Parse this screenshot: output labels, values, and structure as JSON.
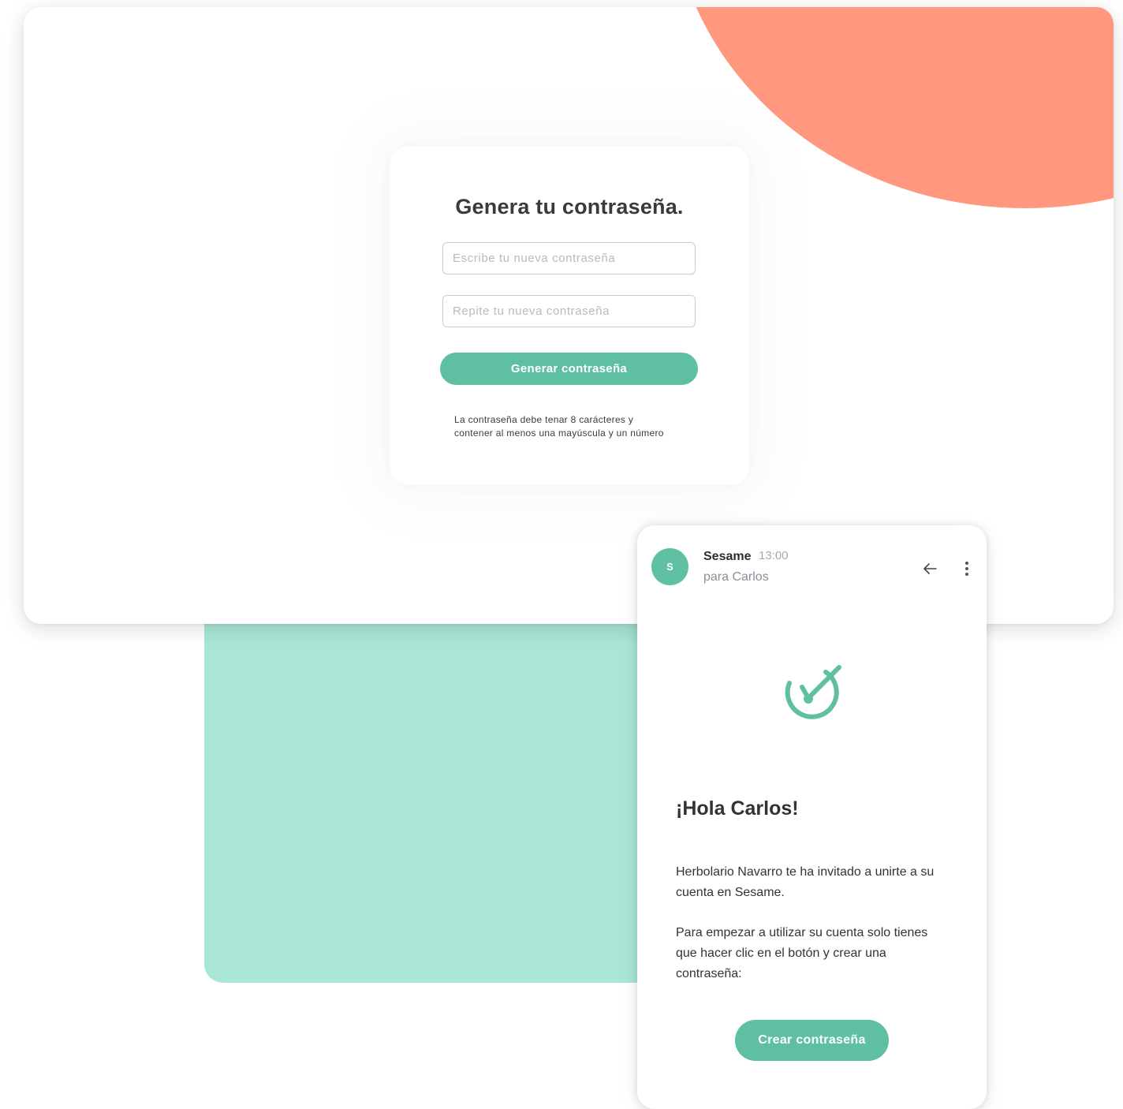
{
  "password_form": {
    "title": "Genera tu contraseña.",
    "new_password_placeholder": "Escribe tu nueva contraseña",
    "repeat_password_placeholder": "Repite tu nueva contraseña",
    "submit_label": "Generar contraseña",
    "hint_line1": "La contraseña debe tenar 8 carácteres y",
    "hint_line2": "contener al menos una mayúscula y un número"
  },
  "email": {
    "avatar_letter": "S",
    "sender": "Sesame",
    "time": "13:00",
    "recipient": "para Carlos",
    "greeting": "¡Hola Carlos!",
    "paragraph1": "Herbolario Navarro te ha invitado a unirte a su cuenta en Sesame.",
    "paragraph2": "Para empezar a utilizar su cuenta solo tienes que hacer clic en el botón y crear una contraseña:",
    "cta_label": "Crear contraseña",
    "icons": {
      "back": "arrow-left-icon",
      "more": "more-vertical-icon",
      "logo": "sesame-clock-check-icon"
    }
  },
  "colors": {
    "brand_green": "#5ebfa3",
    "mint_background": "#a9e6d7",
    "coral_accent": "#ff987f",
    "text_dark": "#333333"
  }
}
